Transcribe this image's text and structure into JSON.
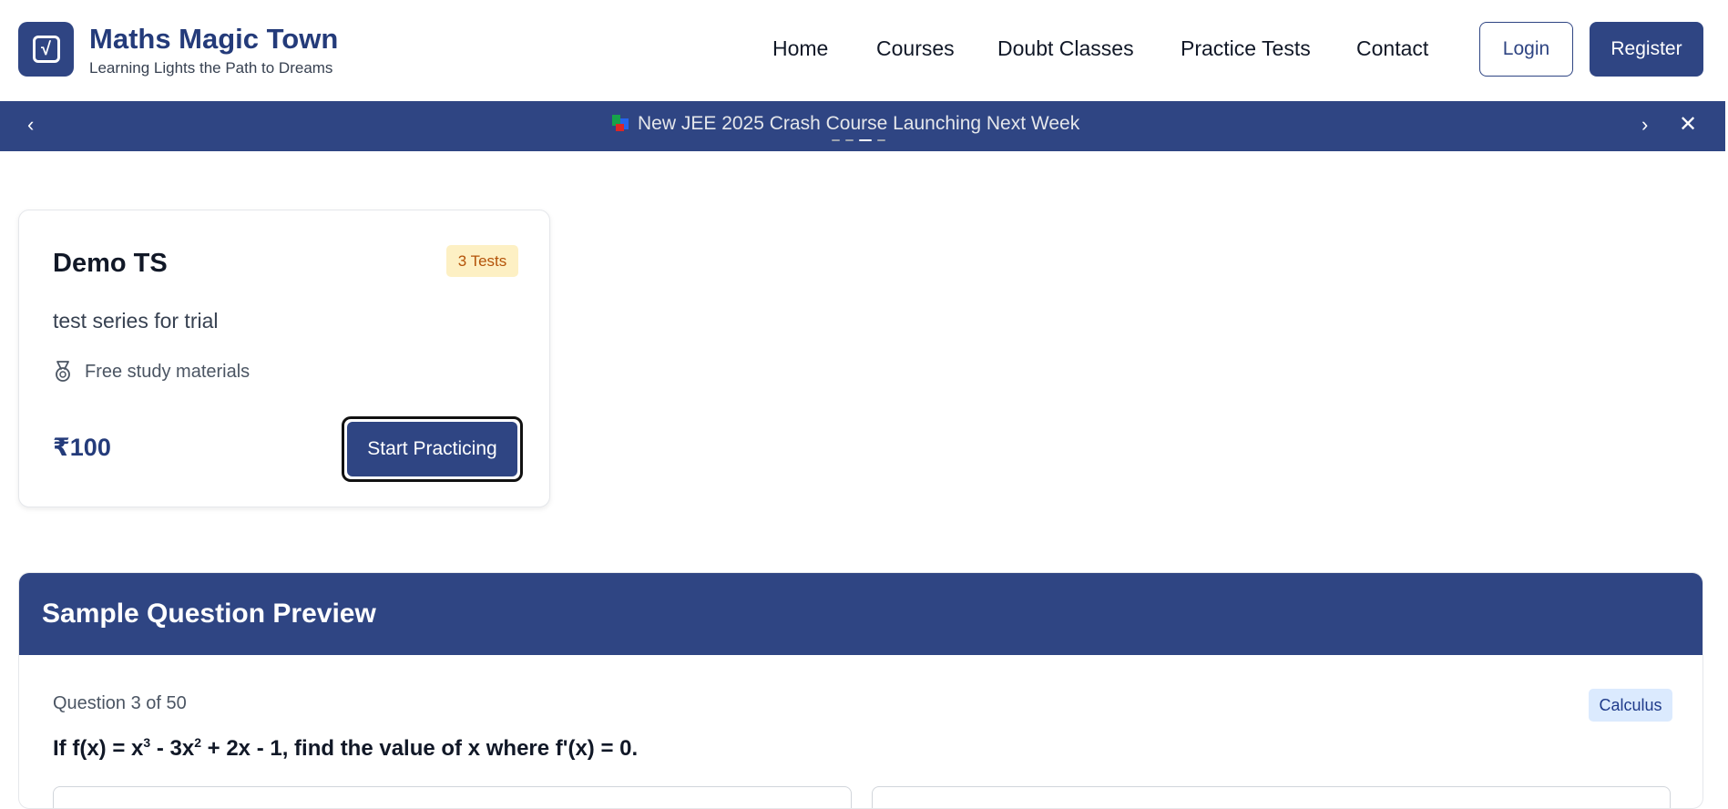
{
  "brand": {
    "title": "Maths Magic Town",
    "tagline": "Learning Lights the Path to Dreams",
    "logo_icon": "square-root-icon"
  },
  "nav": {
    "items": [
      "Home",
      "Courses",
      "Doubt Classes",
      "Practice Tests",
      "Contact"
    ]
  },
  "auth": {
    "login_label": "Login",
    "register_label": "Register"
  },
  "announcement": {
    "text": "New JEE 2025 Crash Course Launching Next Week",
    "prev_icon": "chevron-left-icon",
    "next_icon": "chevron-right-icon",
    "close_icon": "close-icon",
    "slide_count": 4,
    "active_slide": 3
  },
  "test_series": {
    "title": "Demo TS",
    "tests_badge": "3 Tests",
    "description": "test series for trial",
    "feature": "Free study materials",
    "feature_icon": "medal-icon",
    "price": "₹100",
    "cta_label": "Start Practicing"
  },
  "sample_question": {
    "heading": "Sample Question Preview",
    "meta": "Question 3 of 50",
    "topic": "Calculus",
    "question_parts": {
      "before": "If f(x) = x",
      "sup1": "3",
      "middle": " - 3x",
      "sup2": "2",
      "after": " + 2x - 1, find the value of x where f'(x) = 0."
    }
  },
  "colors": {
    "primary": "#2f4583",
    "brand_text": "#243b7a",
    "badge_bg": "#fdf0c4",
    "badge_text": "#b45309",
    "topic_bg": "#dbeafe"
  }
}
